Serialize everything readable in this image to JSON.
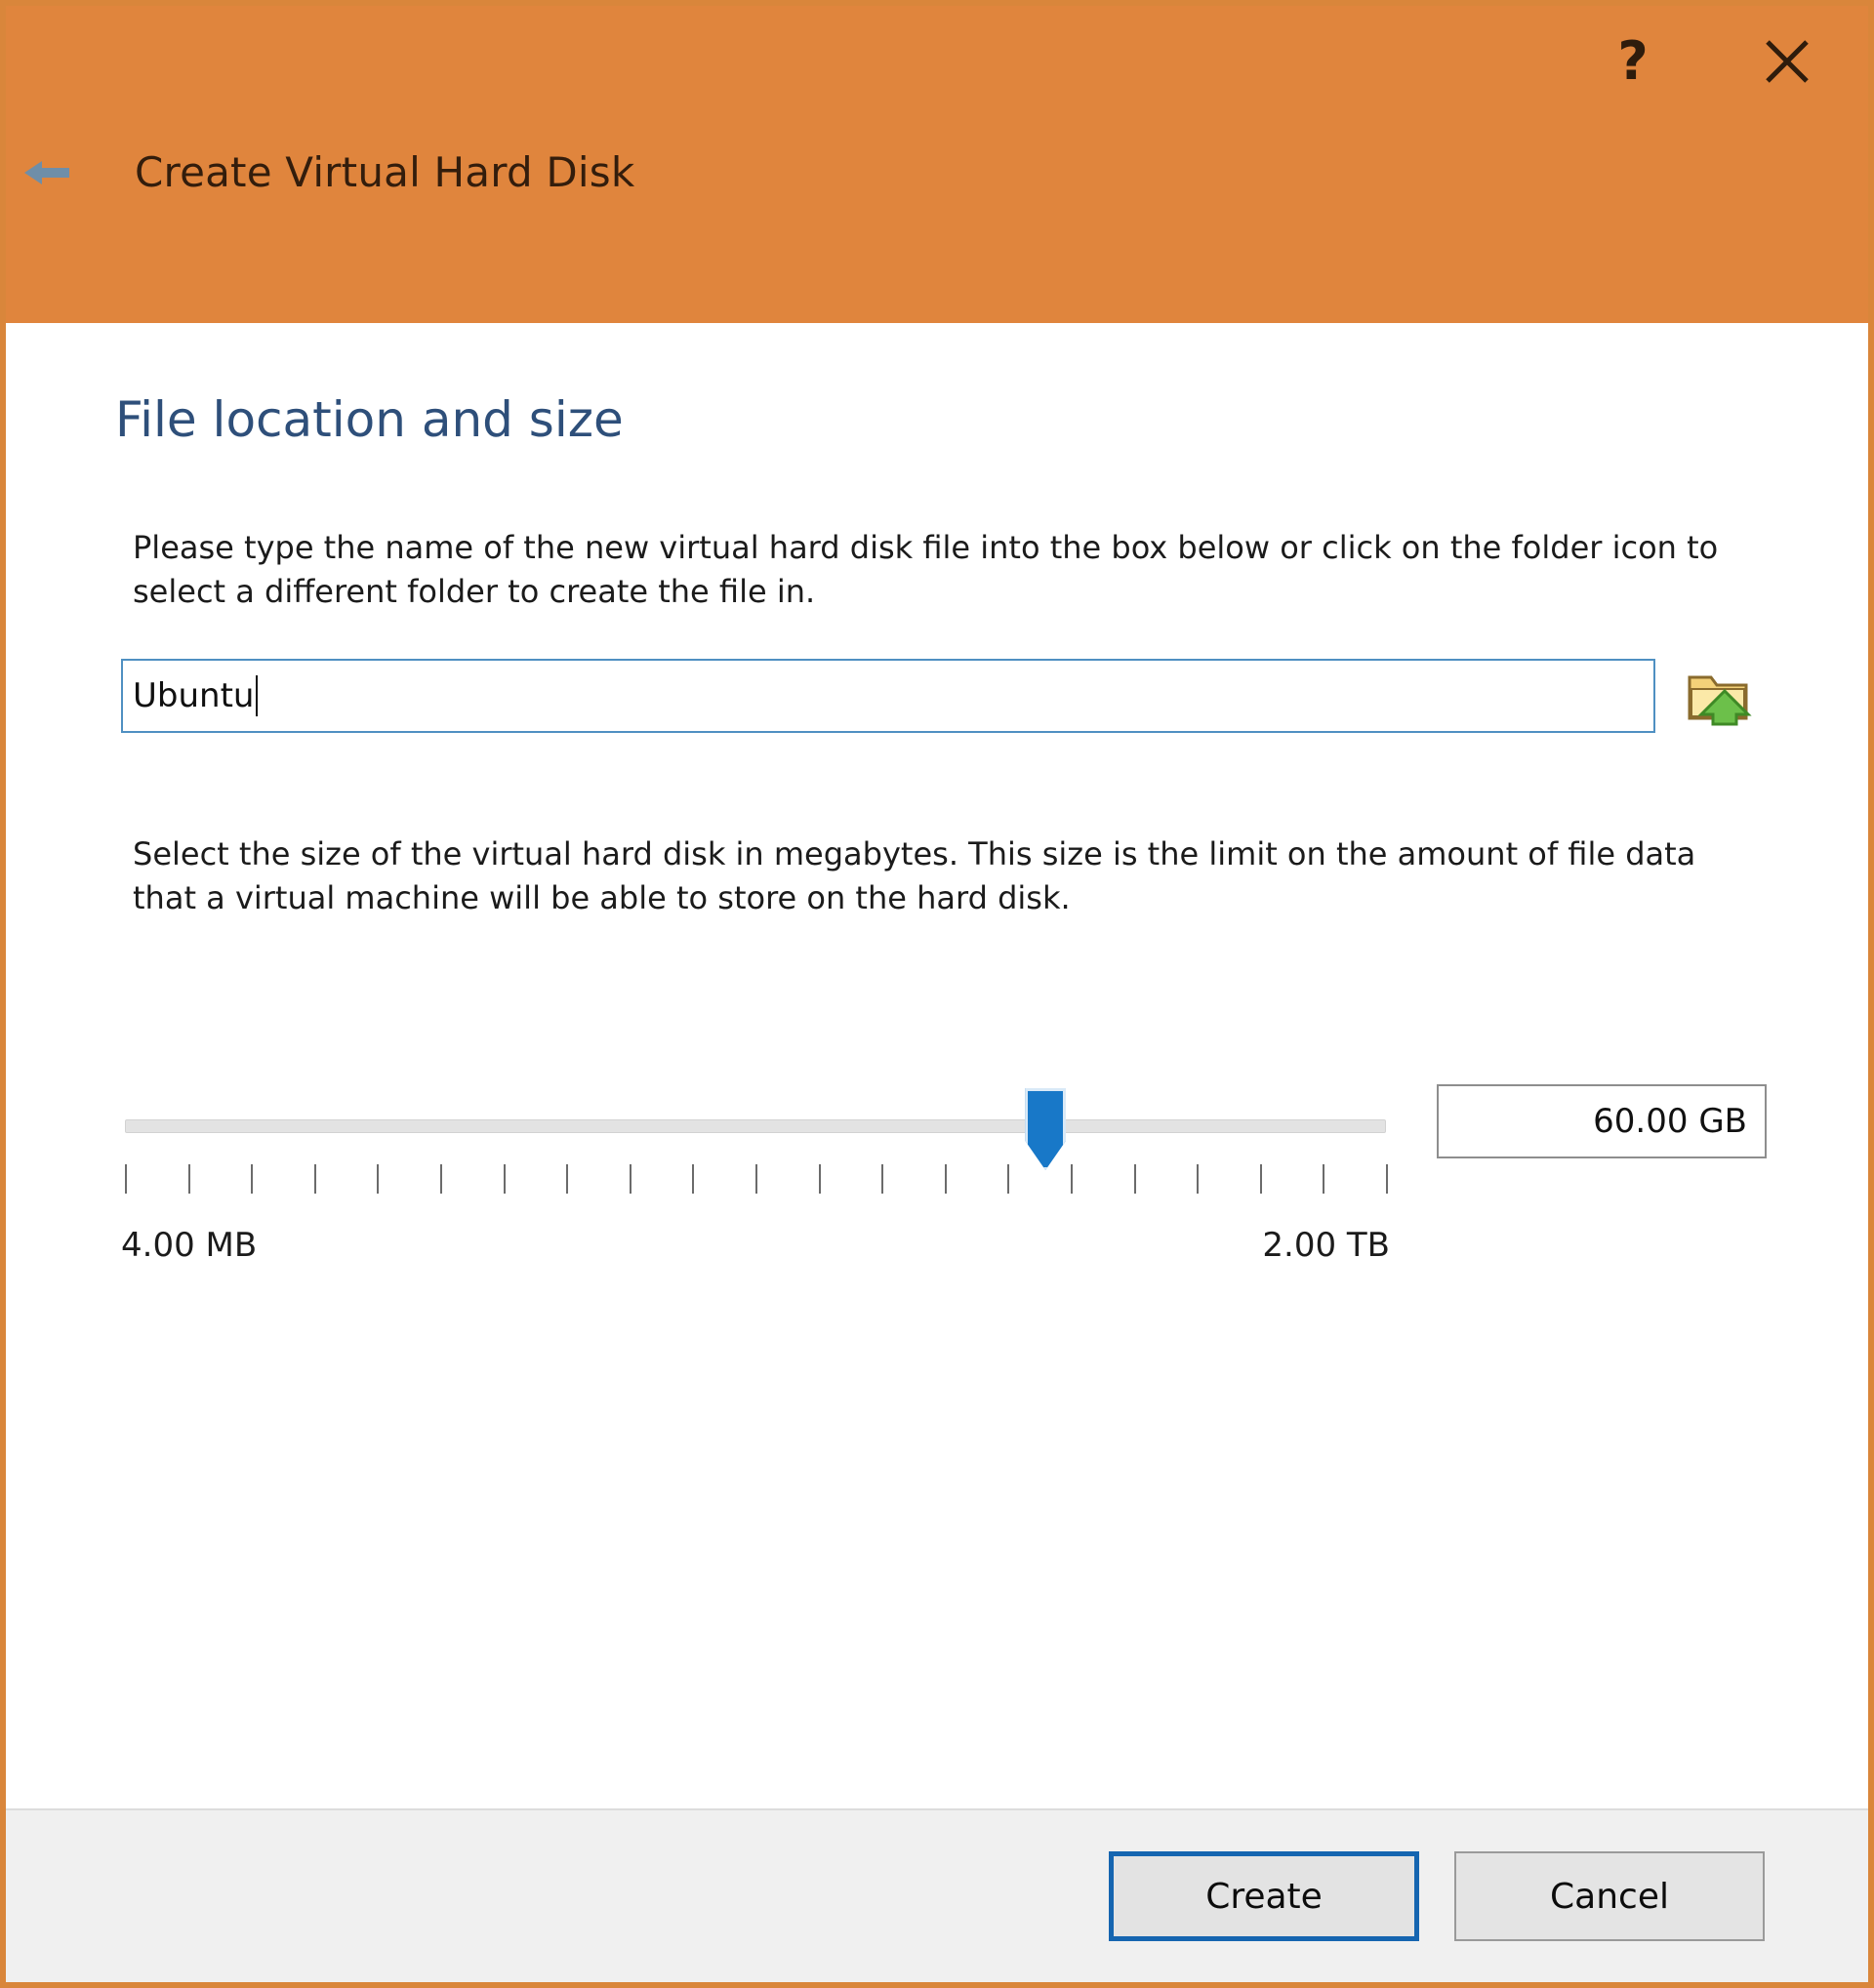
{
  "window": {
    "accent_color": "#e0853d",
    "border_color": "#d9863b",
    "title": "Create Virtual Hard Disk",
    "back_icon": "back-arrow-icon",
    "help_label": "?",
    "close_label": "✕"
  },
  "page": {
    "heading": "File location and size",
    "heading_color": "#2e4f7a",
    "intro_text": "Please type the name of the new virtual hard disk file into the box below or click on the folder icon to select a different folder to create the file in.",
    "size_text": "Select the size of the virtual hard disk in megabytes. This size is the limit on the amount of file data that a virtual machine will be able to store on the hard disk."
  },
  "filename_field": {
    "value": "Ubuntu",
    "placeholder": "Ubuntu",
    "browse_icon": "folder-open-icon",
    "border_color": "#4f90c2"
  },
  "size_slider": {
    "value_label": "60.00 GB",
    "min_label": "4.00 MB",
    "max_label": "2.00 TB",
    "handle_position_percent": 73,
    "tick_count": 21,
    "handle_color": "#1878c8",
    "track_color": "#e3e3e3"
  },
  "footer": {
    "create_label": "Create",
    "cancel_label": "Cancel",
    "default_button_outline": "#1565b0"
  }
}
